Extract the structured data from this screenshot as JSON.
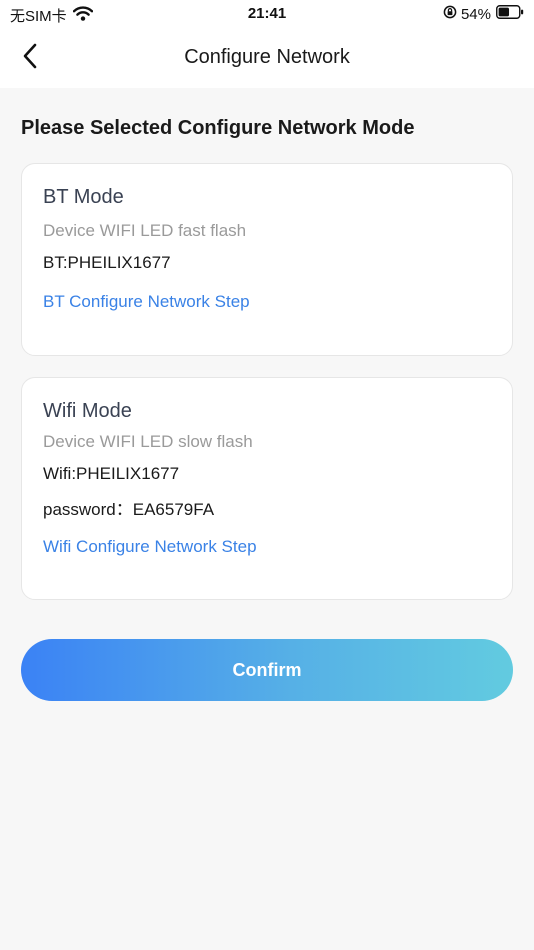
{
  "status_bar": {
    "carrier": "无SIM卡",
    "time": "21:41",
    "battery_percent": "54%",
    "battery_level": 0.54,
    "icons": [
      "wifi-icon",
      "orientation-lock-icon",
      "battery-icon"
    ]
  },
  "nav": {
    "title": "Configure Network",
    "back_icon": "chevron-left-icon"
  },
  "main": {
    "heading": "Please Selected Configure Network Mode",
    "bt_card": {
      "title": "BT Mode",
      "description": "Device WIFI LED fast flash",
      "device_name": "BT:PHEILIX1677",
      "link": "BT Configure Network Step"
    },
    "wifi_card": {
      "title": "Wifi Mode",
      "description": "Device WIFI LED slow flash",
      "ssid": "Wifi:PHEILIX1677",
      "password": "password：EA6579FA",
      "link": "Wifi Configure Network Step"
    },
    "confirm_label": "Confirm"
  },
  "colors": {
    "link": "#3a82e6",
    "button_gradient_start": "#3b82f5",
    "button_gradient_end": "#62cbe0",
    "background": "#f7f7f7"
  }
}
